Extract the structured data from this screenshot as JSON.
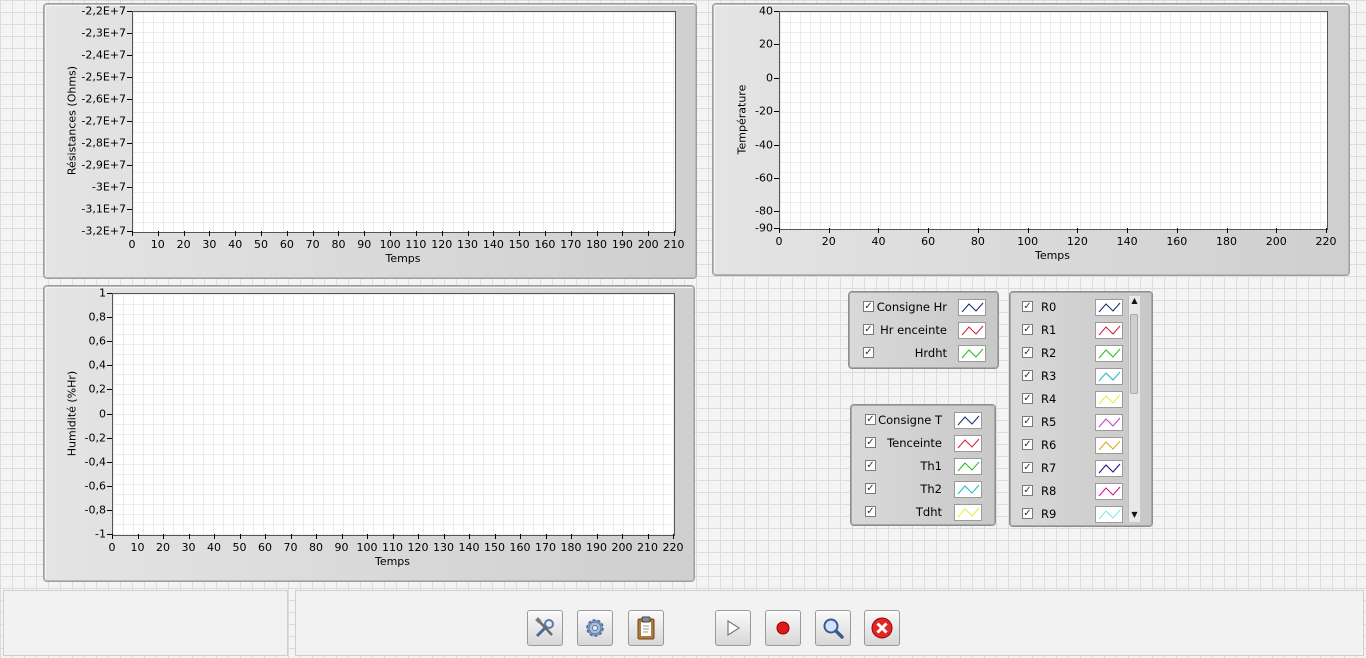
{
  "graphs": {
    "resistances": {
      "y_title": "Résistances (Ohms)",
      "x_title": "Temps",
      "y_ticks": [
        "-2,2E+7",
        "-2,3E+7",
        "-2,4E+7",
        "-2,5E+7",
        "-2,6E+7",
        "-2,7E+7",
        "-2,8E+7",
        "-2,9E+7",
        "-3E+7",
        "-3,1E+7",
        "-3,2E+7"
      ],
      "x_ticks": [
        "0",
        "10",
        "20",
        "30",
        "40",
        "50",
        "60",
        "70",
        "80",
        "90",
        "100",
        "110",
        "120",
        "130",
        "140",
        "150",
        "160",
        "170",
        "180",
        "190",
        "200",
        "210"
      ]
    },
    "temperature": {
      "y_title": "Température",
      "x_title": "Temps",
      "y_ticks": [
        "40",
        "20",
        "0",
        "-20",
        "-40",
        "-60",
        "-80",
        "-90"
      ],
      "y_values": [
        40,
        20,
        0,
        -20,
        -40,
        -60,
        -80,
        -90
      ],
      "x_ticks": [
        "0",
        "20",
        "40",
        "60",
        "80",
        "100",
        "120",
        "140",
        "160",
        "180",
        "200",
        "220"
      ]
    },
    "humidity": {
      "y_title": "Humidité (%Hr)",
      "x_title": "Temps",
      "y_ticks": [
        "1",
        "0,8",
        "0,6",
        "0,4",
        "0,2",
        "0",
        "-0,2",
        "-0,4",
        "-0,6",
        "-0,8",
        "-1"
      ],
      "x_ticks": [
        "0",
        "10",
        "20",
        "30",
        "40",
        "50",
        "60",
        "70",
        "80",
        "90",
        "100",
        "110",
        "120",
        "130",
        "140",
        "150",
        "160",
        "170",
        "180",
        "190",
        "200",
        "210",
        "220"
      ]
    }
  },
  "legend_hr": [
    {
      "label": "Consigne Hr",
      "color": "#1a2a6e",
      "checked": true
    },
    {
      "label": "Hr enceinte",
      "color": "#d61c3a",
      "checked": true
    },
    {
      "label": "Hrdht",
      "color": "#1fbf1f",
      "checked": true
    }
  ],
  "legend_t": [
    {
      "label": "Consigne T",
      "color": "#1a2a6e",
      "checked": true
    },
    {
      "label": "Tenceinte",
      "color": "#d61c3a",
      "checked": true
    },
    {
      "label": "Th1",
      "color": "#1fbf1f",
      "checked": true
    },
    {
      "label": "Th2",
      "color": "#20b8c8",
      "checked": true
    },
    {
      "label": "Tdht",
      "color": "#e6ea40",
      "checked": true
    }
  ],
  "legend_r": [
    {
      "label": "R0",
      "color": "#1a2a6e",
      "checked": true
    },
    {
      "label": "R1",
      "color": "#d61c3a",
      "checked": true
    },
    {
      "label": "R2",
      "color": "#1fbf1f",
      "checked": true
    },
    {
      "label": "R3",
      "color": "#20b8c8",
      "checked": true
    },
    {
      "label": "R4",
      "color": "#e6ea40",
      "checked": true
    },
    {
      "label": "R5",
      "color": "#c040c8",
      "checked": true
    },
    {
      "label": "R6",
      "color": "#e6a018",
      "checked": true
    },
    {
      "label": "R7",
      "color": "#101080",
      "checked": true
    },
    {
      "label": "R8",
      "color": "#d01090",
      "checked": true
    },
    {
      "label": "R9",
      "color": "#80e8f0",
      "checked": true
    }
  ],
  "toolbar": [
    {
      "name": "tools-button",
      "icon": "tools-icon"
    },
    {
      "name": "settings-button",
      "icon": "gear-icon"
    },
    {
      "name": "clipboard-button",
      "icon": "clipboard-icon"
    },
    {
      "name": "run-button",
      "icon": "play-icon"
    },
    {
      "name": "record-button",
      "icon": "record-icon"
    },
    {
      "name": "search-button",
      "icon": "magnifier-icon"
    },
    {
      "name": "close-button",
      "icon": "close-icon"
    }
  ]
}
